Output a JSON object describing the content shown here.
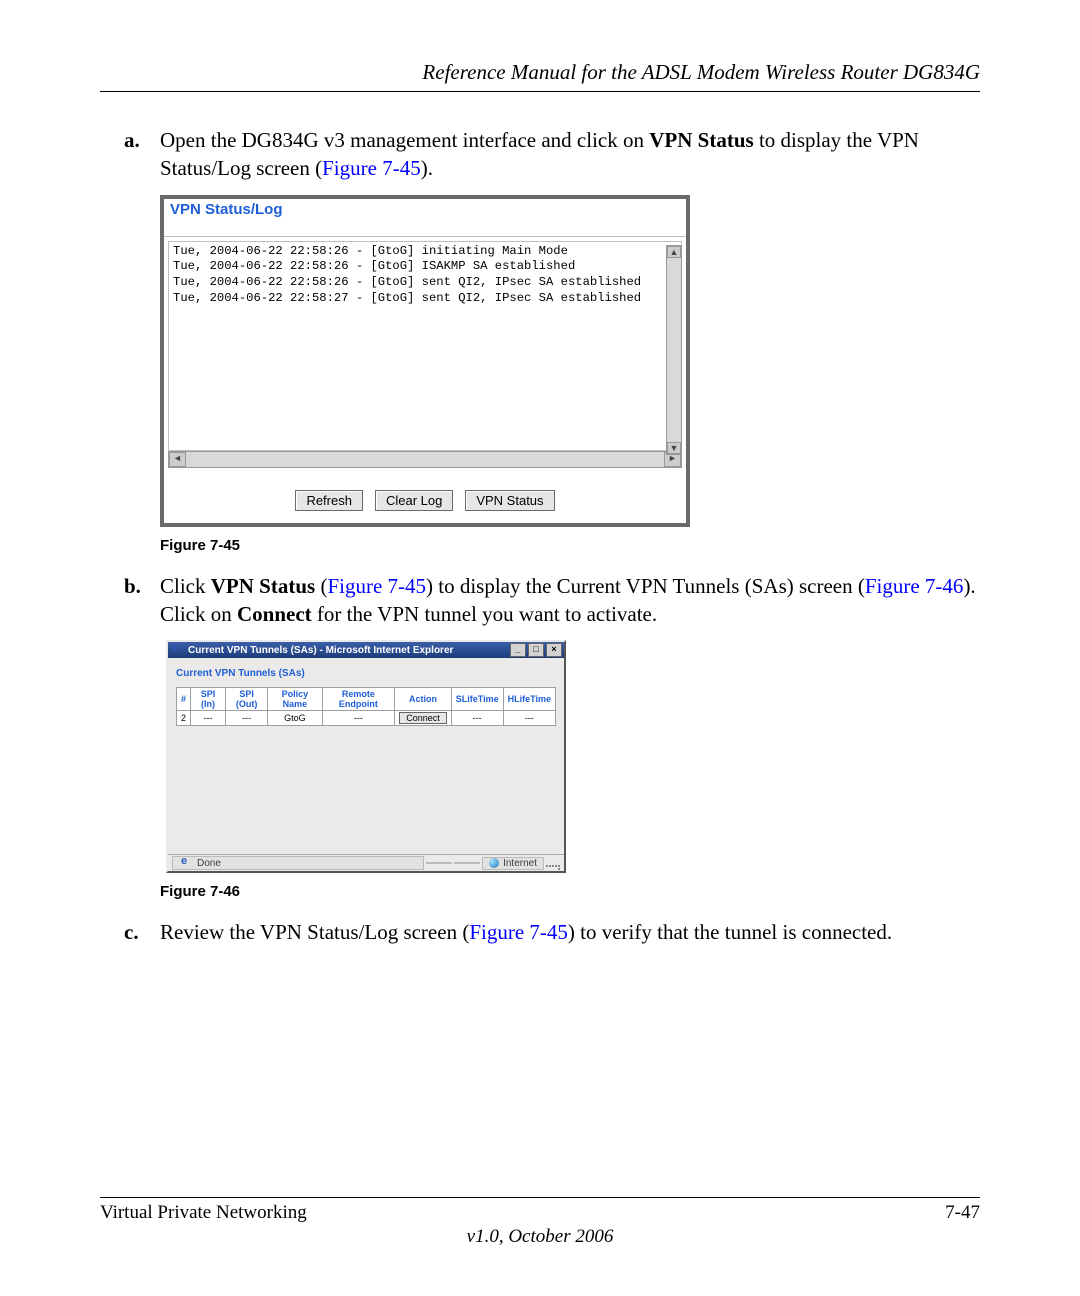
{
  "header_title": "Reference Manual for the ADSL Modem Wireless Router DG834G",
  "item_a": {
    "marker": "a.",
    "pre": "Open the DG834G v3 management interface and click on ",
    "bold": "VPN Status",
    "post": " to display the VPN Status/Log screen (",
    "figref": "Figure 7-45",
    "tail": ")."
  },
  "vpn_log": {
    "title": "VPN Status/Log",
    "lines": "Tue, 2004-06-22 22:58:26 - [GtoG] initiating Main Mode\nTue, 2004-06-22 22:58:26 - [GtoG] ISAKMP SA established\nTue, 2004-06-22 22:58:26 - [GtoG] sent QI2, IPsec SA established\nTue, 2004-06-22 22:58:27 - [GtoG] sent QI2, IPsec SA established",
    "buttons": {
      "refresh": "Refresh",
      "clear": "Clear Log",
      "status": "VPN Status"
    }
  },
  "fig45_caption": "Figure 7-45",
  "item_b": {
    "marker": "b.",
    "pre": "Click ",
    "bold1": "VPN Status",
    "mid1": " (",
    "figref1": "Figure 7-45",
    "mid2": ") to display the Current VPN Tunnels (SAs) screen (",
    "figref2": "Figure 7-46",
    "mid3": "). Click on ",
    "bold2": "Connect",
    "post": " for the VPN tunnel you want to activate."
  },
  "ie": {
    "title": "Current VPN Tunnels (SAs) - Microsoft Internet Explorer",
    "min": "_",
    "max": "□",
    "close": "×",
    "section": "Current VPN Tunnels (SAs)",
    "headers": {
      "n": "#",
      "spiin": "SPI (In)",
      "spiout": "SPI (Out)",
      "policy": "Policy Name",
      "remote": "Remote Endpoint",
      "action": "Action",
      "slife": "SLifeTime",
      "hlife": "HLifeTime"
    },
    "row": {
      "n": "2",
      "spiin": "---",
      "spiout": "---",
      "policy": "GtoG",
      "remote": "---",
      "connect": "Connect",
      "slife": "---",
      "hlife": "---"
    },
    "status_done": "Done",
    "status_zone": "Internet"
  },
  "fig46_caption": "Figure 7-46",
  "item_c": {
    "marker": "c.",
    "pre": "Review the VPN Status/Log screen (",
    "figref": "Figure 7-45",
    "post": ") to verify that the tunnel is connected."
  },
  "footer": {
    "left": "Virtual Private Networking",
    "right": "7-47",
    "version": "v1.0, October 2006"
  }
}
